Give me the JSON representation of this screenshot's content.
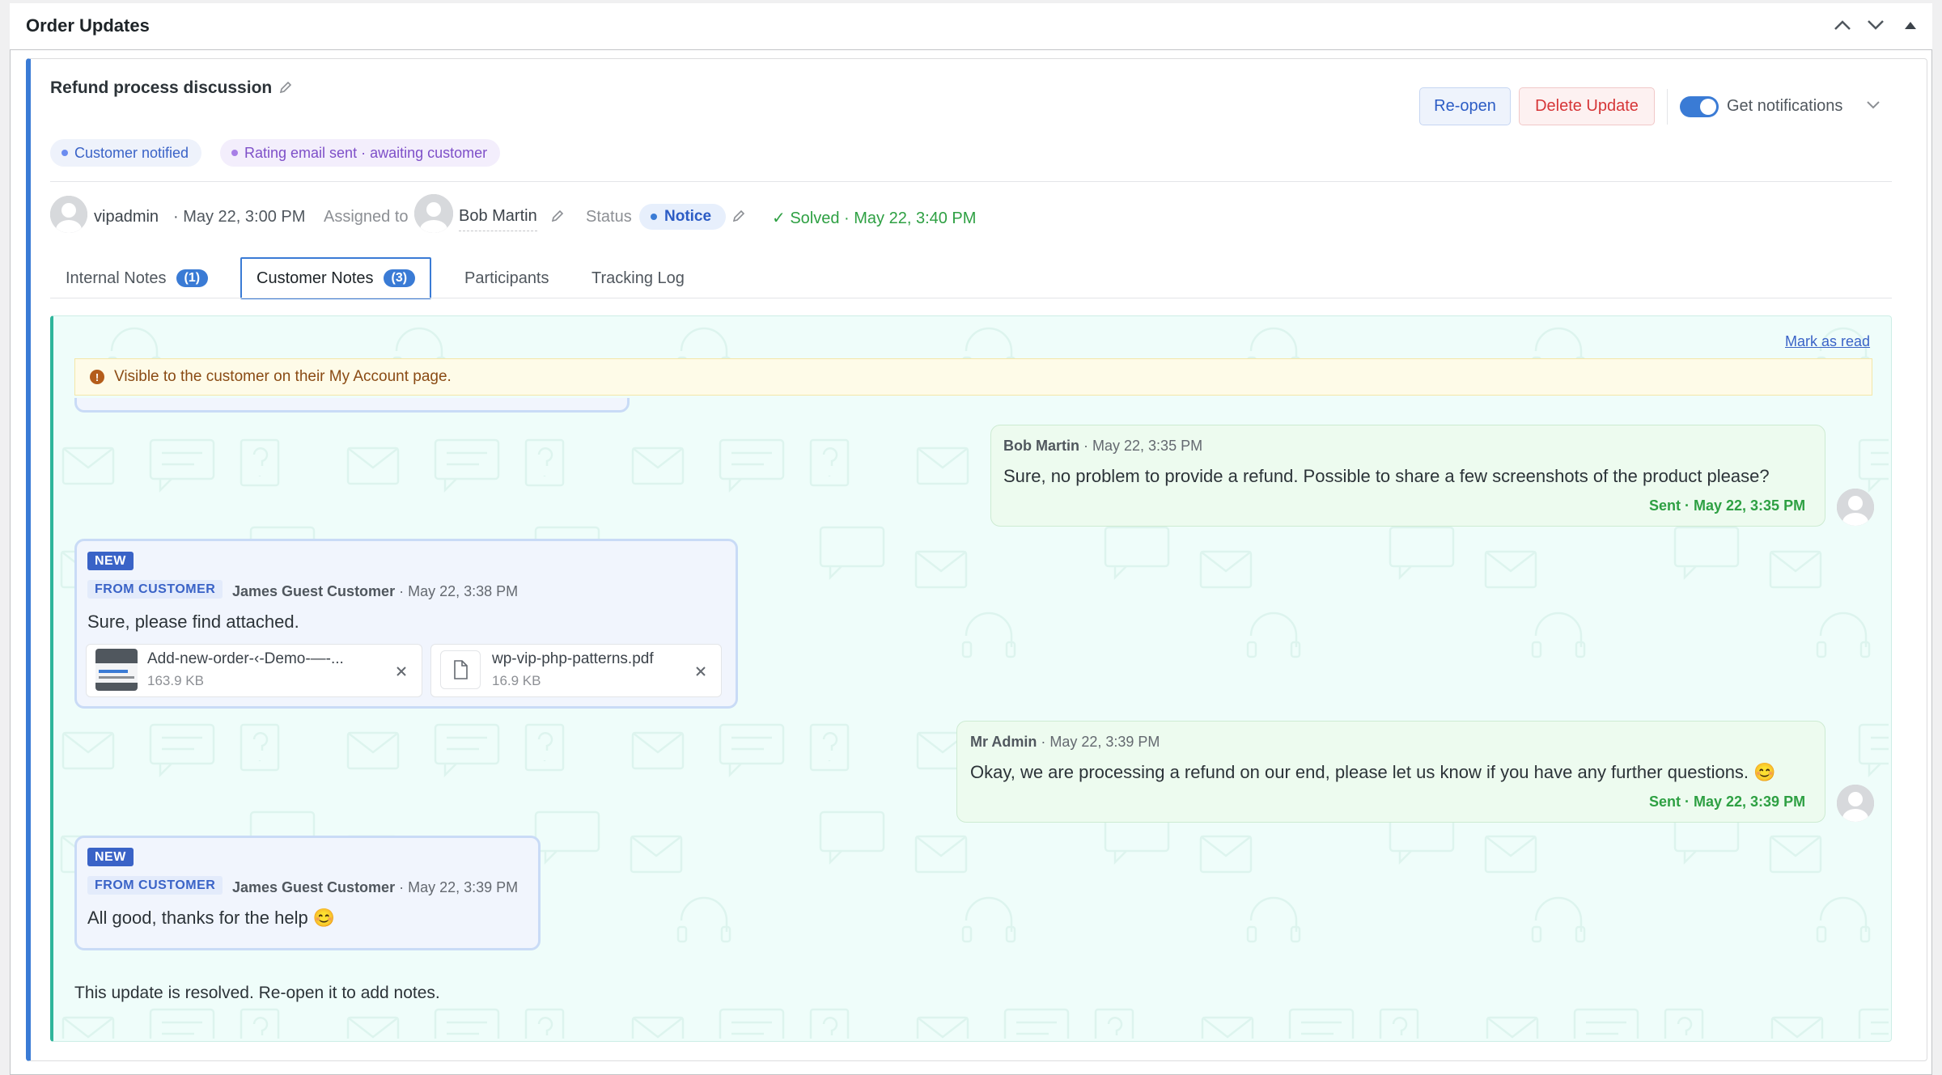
{
  "panel": {
    "title": "Order Updates"
  },
  "update": {
    "title": "Refund process discussion",
    "reopen_label": "Re-open",
    "delete_label": "Delete Update",
    "notifications_label": "Get notifications",
    "notifications_on": true,
    "chips": [
      "Customer notified",
      "Rating email sent · awaiting customer"
    ],
    "author": "vipadmin",
    "created": "· May 22, 3:00 PM",
    "assigned_label": "Assigned to",
    "assignee": "Bob Martin",
    "status_label": "Status",
    "status_value": "Notice",
    "solved": "✓ Solved · May 22, 3:40 PM"
  },
  "tabs": [
    {
      "label": "Internal Notes",
      "count": "(1)"
    },
    {
      "label": "Customer Notes",
      "count": "(3)",
      "active": true
    },
    {
      "label": "Participants"
    },
    {
      "label": "Tracking Log"
    }
  ],
  "notes": {
    "mark_read": "Mark as read",
    "notice": "Visible to the customer on their My Account page.",
    "messages": [
      {
        "author": "Bob Martin",
        "time": "· May 22, 3:35 PM",
        "text": "Sure, no problem to provide a refund. Possible to share a few screenshots of the product please?",
        "sent": "Sent · May 22, 3:35 PM"
      },
      {
        "badge_new": "NEW",
        "badge_from": "FROM CUSTOMER",
        "author": "James Guest Customer",
        "time": "· May 22, 3:38 PM",
        "text": "Sure, please find attached.",
        "attachments": [
          {
            "name": "Add-new-order-‹-Demo-—-...",
            "size": "163.9 KB"
          },
          {
            "name": "wp-vip-php-patterns.pdf",
            "size": "16.9 KB"
          }
        ]
      },
      {
        "author": "Mr Admin",
        "time": "· May 22, 3:39 PM",
        "text": "Okay, we are processing a refund on our end, please let us know if you have any further questions. 😊",
        "sent": "Sent · May 22, 3:39 PM"
      },
      {
        "badge_new": "NEW",
        "badge_from": "FROM CUSTOMER",
        "author": "James Guest Customer",
        "time": "· May 22, 3:39 PM",
        "text": "All good, thanks for the help 😊"
      }
    ],
    "resolved": "This update is resolved. Re-open it to add notes."
  },
  "colors": {
    "accent": "#3a7bd5",
    "success": "#2ea043",
    "danger": "#d63638",
    "notes_bg": "#effdfa"
  }
}
